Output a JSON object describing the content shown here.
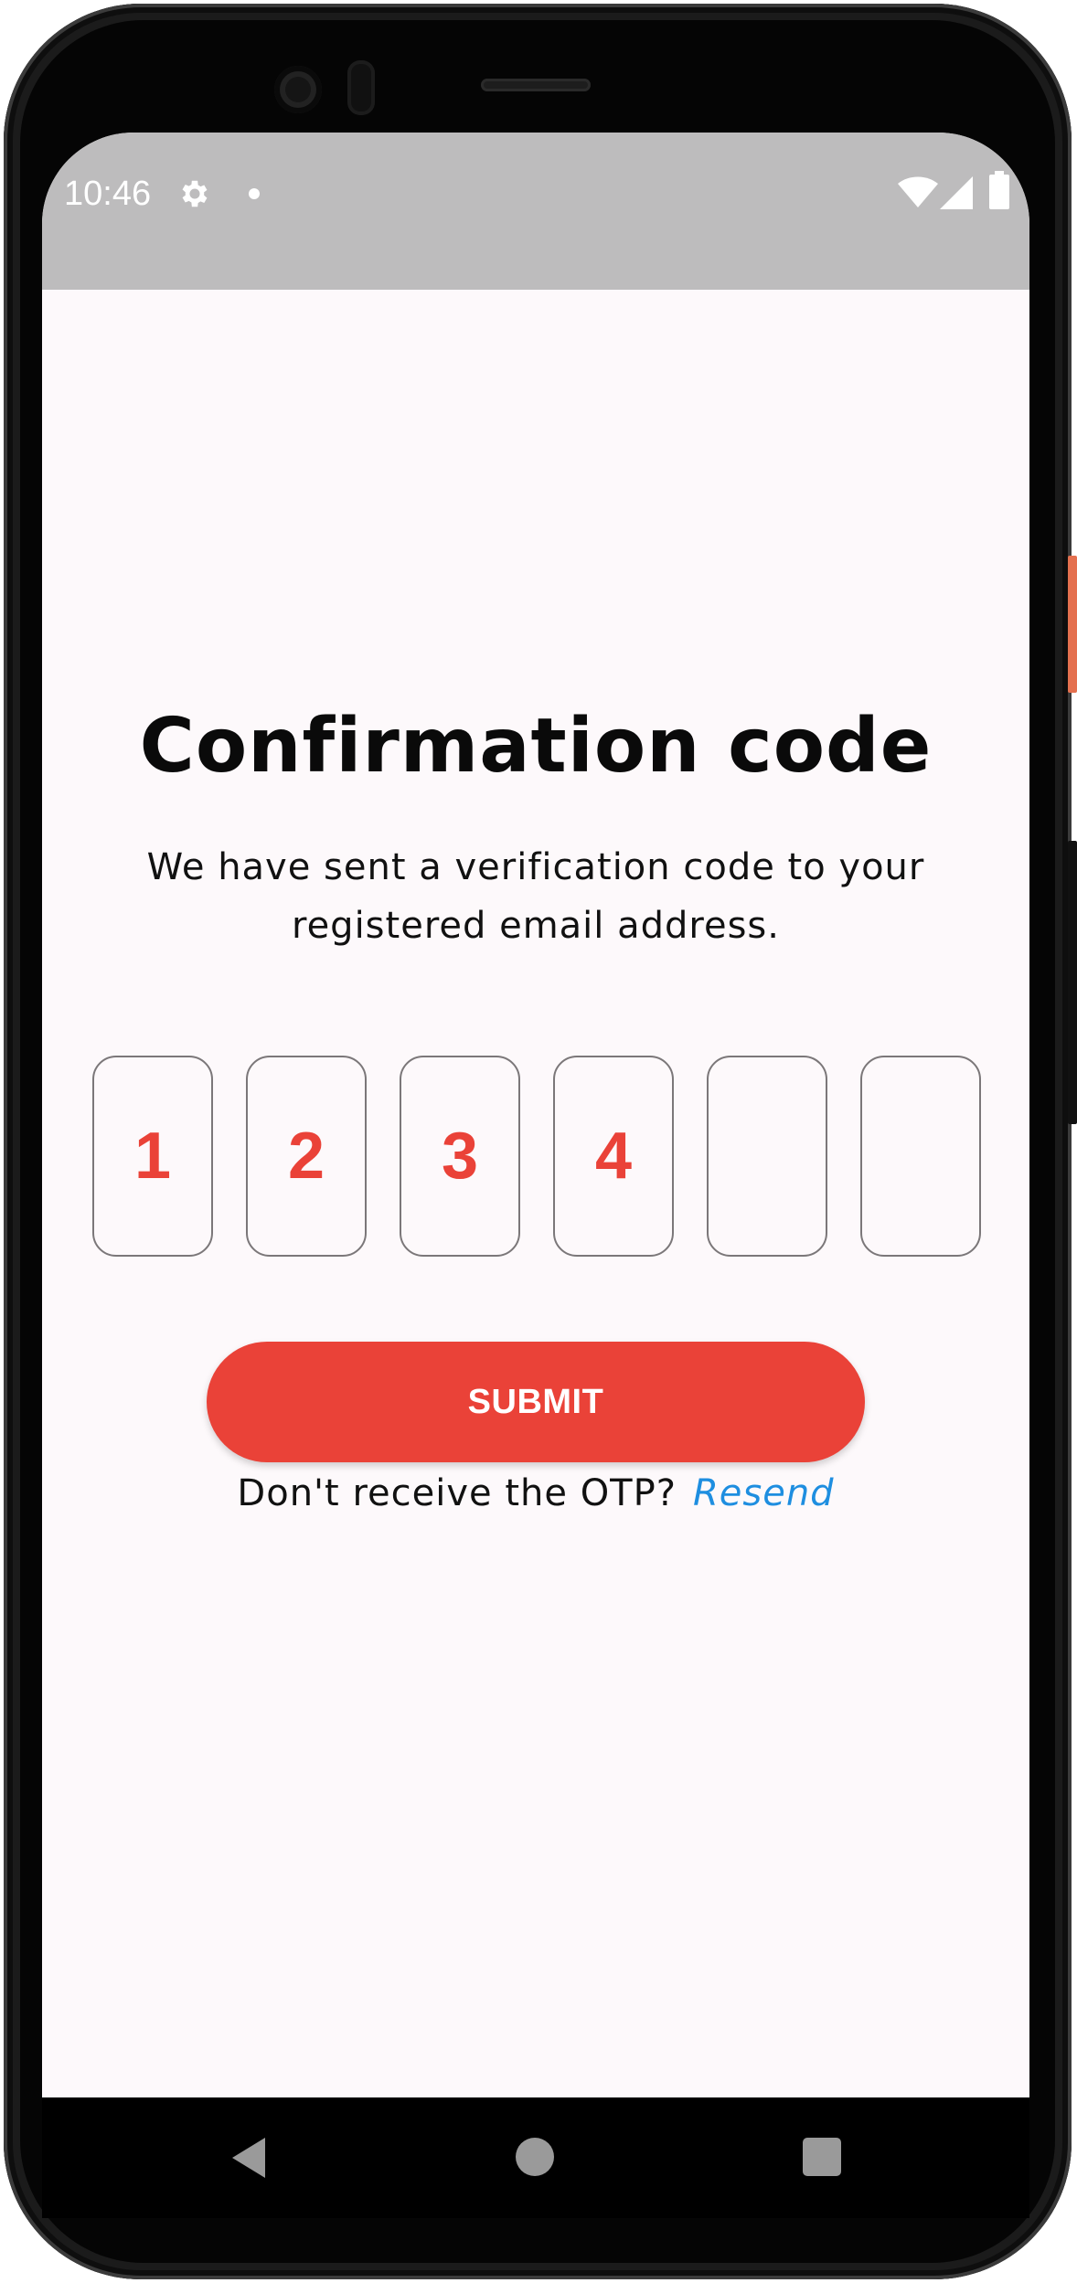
{
  "status_bar": {
    "time": "10:46",
    "icons": [
      "gear-icon",
      "dot-icon",
      "wifi-icon",
      "signal-icon",
      "battery-icon"
    ],
    "background": "#bdbcbd"
  },
  "screen": {
    "title": "Confirmation code",
    "subtitle": "We have sent a verification code to your registered email address.",
    "otp": {
      "digits": [
        "1",
        "2",
        "3",
        "4",
        "",
        ""
      ],
      "digit_color": "#ea4238"
    },
    "submit_label": "SUBMIT",
    "resend_prompt": "Don't receive the OTP?",
    "resend_label": "Resend",
    "accent_color": "#ea4238",
    "link_color": "#1e8ee0"
  },
  "nav_bar": {
    "icons": [
      "back-icon",
      "home-icon",
      "recents-icon"
    ]
  }
}
